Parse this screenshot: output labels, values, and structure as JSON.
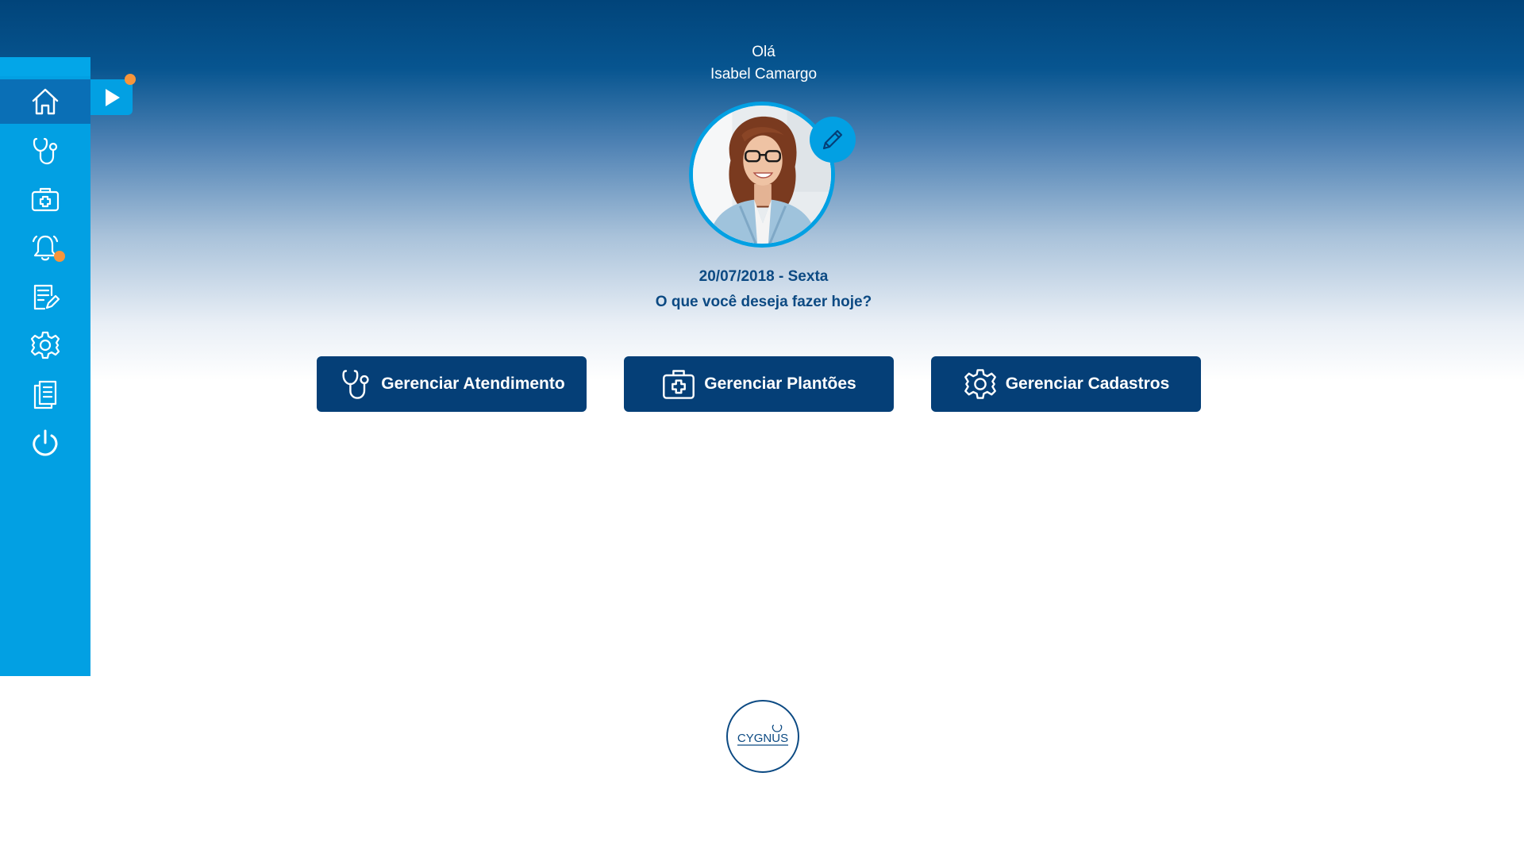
{
  "greeting": {
    "hello": "Olá",
    "user_name": "Isabel Camargo"
  },
  "date_line": "20/07/2018 - Sexta",
  "question": "O que você deseja fazer hoje?",
  "actions": [
    {
      "label": "Gerenciar Atendimento",
      "icon": "stethoscope-icon"
    },
    {
      "label": "Gerenciar Plantões",
      "icon": "medical-kit-icon"
    },
    {
      "label": "Gerenciar Cadastros",
      "icon": "gear-icon"
    }
  ],
  "sidebar": {
    "items": [
      {
        "icon": "home-icon",
        "active": true
      },
      {
        "icon": "stethoscope-icon"
      },
      {
        "icon": "medical-kit-icon"
      },
      {
        "icon": "bell-icon",
        "notification": true
      },
      {
        "icon": "document-edit-icon"
      },
      {
        "icon": "gear-icon"
      },
      {
        "icon": "documents-icon"
      },
      {
        "icon": "power-icon"
      }
    ],
    "expand_icon": "play-icon"
  },
  "logo_text": "CYGNUS",
  "colors": {
    "sidebar": "#02a0e3",
    "sidebar_active": "#0a6fb6",
    "button": "#053f77",
    "text_dark": "#0c4a83",
    "notification": "#f7953b"
  }
}
